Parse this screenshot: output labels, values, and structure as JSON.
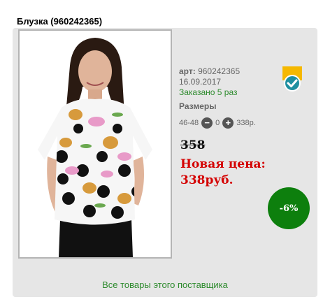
{
  "product": {
    "title": "Блузка (960242365)",
    "art_label": "арт:",
    "art_value": "960242365",
    "date": "16.09.2017",
    "ordered": "Заказано 5 раз",
    "sizes_label": "Размеры",
    "size_range": "46-48",
    "quantity": "0",
    "size_price": "338р.",
    "old_price": "358",
    "new_price_label": "Новая цена:",
    "new_price": "338руб.",
    "discount": "-6%",
    "supplier_link": "Все товары этого поставщика"
  },
  "icons": {
    "minus": "minus-icon",
    "plus": "plus-icon",
    "verified": "verified-check-icon"
  },
  "colors": {
    "accent_green": "#2e8b2e",
    "price_red": "#d40000",
    "discount_bg": "#0d7f0d",
    "badge_yellow": "#f5b800",
    "badge_teal": "#1e8fa0"
  }
}
